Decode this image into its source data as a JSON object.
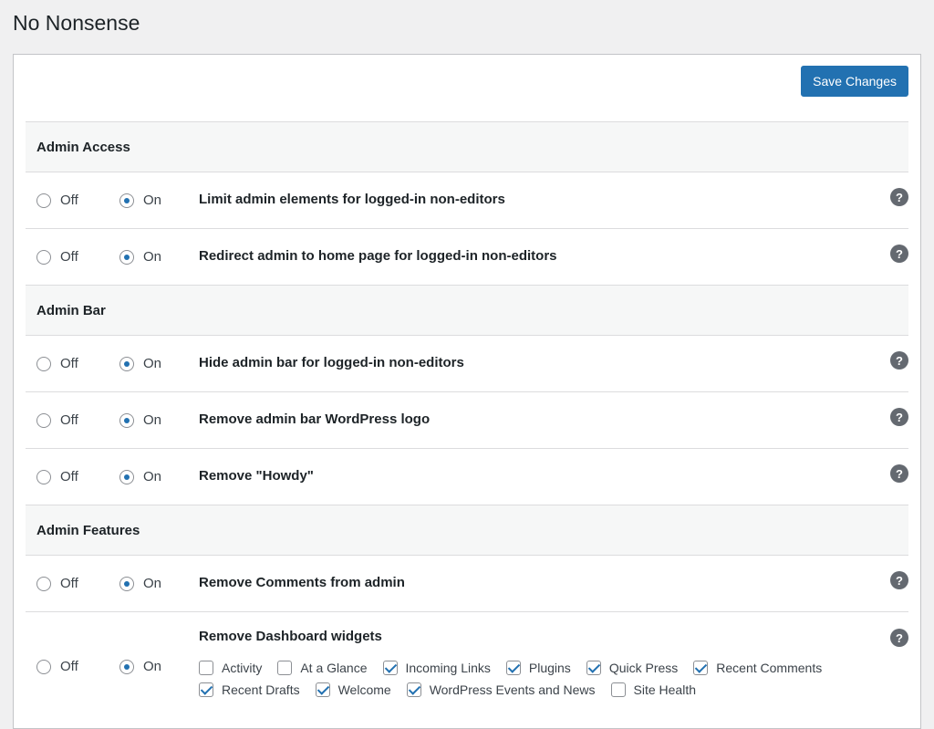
{
  "page": {
    "title": "No Nonsense"
  },
  "toolbar": {
    "save_label": "Save Changes"
  },
  "radio_labels": {
    "off": "Off",
    "on": "On"
  },
  "help": "?",
  "sections": [
    {
      "title": "Admin Access",
      "rows": [
        {
          "label": "Limit admin elements for logged-in non-editors",
          "value": "On"
        },
        {
          "label": "Redirect admin to home page for logged-in non-editors",
          "value": "On"
        }
      ]
    },
    {
      "title": "Admin Bar",
      "rows": [
        {
          "label": "Hide admin bar for logged-in non-editors",
          "value": "On"
        },
        {
          "label": "Remove admin bar WordPress logo",
          "value": "On"
        },
        {
          "label": "Remove \"Howdy\"",
          "value": "On"
        }
      ]
    },
    {
      "title": "Admin Features",
      "rows": [
        {
          "label": "Remove Comments from admin",
          "value": "On"
        },
        {
          "label": "Remove Dashboard widgets",
          "value": "On",
          "checkboxes": [
            [
              {
                "label": "Activity",
                "checked": false
              },
              {
                "label": "At a Glance",
                "checked": false
              },
              {
                "label": "Incoming Links",
                "checked": true
              },
              {
                "label": "Plugins",
                "checked": true
              },
              {
                "label": "Quick Press",
                "checked": true
              },
              {
                "label": "Recent Comments",
                "checked": true
              }
            ],
            [
              {
                "label": "Recent Drafts",
                "checked": true
              },
              {
                "label": "Welcome",
                "checked": true
              },
              {
                "label": "WordPress Events and News",
                "checked": true
              },
              {
                "label": "Site Health",
                "checked": false
              }
            ]
          ]
        }
      ]
    }
  ]
}
